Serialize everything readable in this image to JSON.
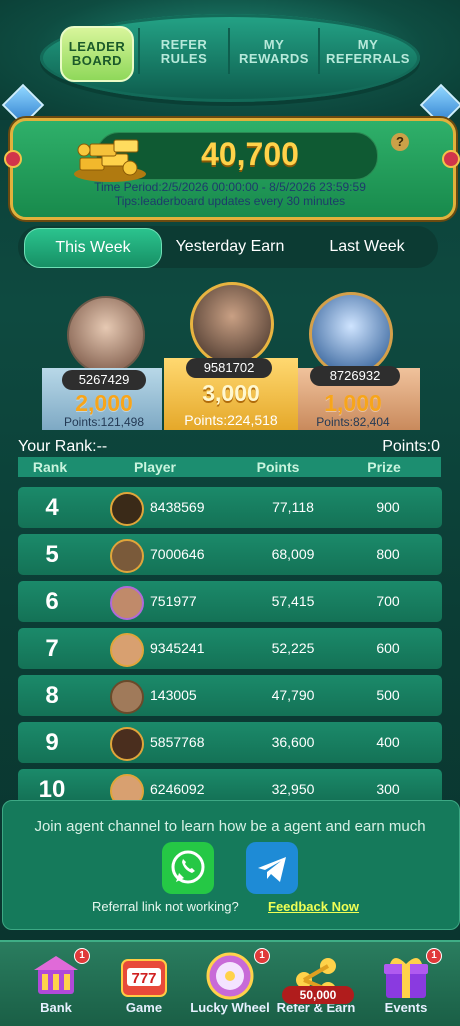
{
  "top_tabs": [
    {
      "label_line1": "LEADER",
      "label_line2": "BOARD"
    },
    {
      "label_line1": "REFER",
      "label_line2": "RULES"
    },
    {
      "label_line1": "MY",
      "label_line2": "REWARDS"
    },
    {
      "label_line1": "MY",
      "label_line2": "REFERRALS"
    }
  ],
  "banner": {
    "points": "40,700",
    "help": "?",
    "time_period": "Time Period:2/5/2026 00:00:00 - 8/5/2026 23:59:59",
    "tips": "Tips:leaderboard updates every 30 minutes"
  },
  "period_tabs": [
    "This Week",
    "Yesterday Earn",
    "Last Week"
  ],
  "podium": [
    {
      "id": "5267429",
      "amount": "2,000",
      "points": "Points:121,498"
    },
    {
      "id": "9581702",
      "amount": "3,000",
      "points": "Points:224,518"
    },
    {
      "id": "8726932",
      "amount": "1,000",
      "points": "Points:82,404"
    }
  ],
  "your_rank": "Your Rank:--",
  "your_points": "Points:0",
  "table_headers": [
    "Rank",
    "Player",
    "Points",
    "Prize"
  ],
  "rows": [
    {
      "rank": "4",
      "player": "8438569",
      "points": "77,118",
      "prize": "900"
    },
    {
      "rank": "5",
      "player": "7000646",
      "points": "68,009",
      "prize": "800"
    },
    {
      "rank": "6",
      "player": "751977",
      "points": "57,415",
      "prize": "700"
    },
    {
      "rank": "7",
      "player": "9345241",
      "points": "52,225",
      "prize": "600"
    },
    {
      "rank": "8",
      "player": "143005",
      "points": "47,790",
      "prize": "500"
    },
    {
      "rank": "9",
      "player": "5857768",
      "points": "36,600",
      "prize": "400"
    },
    {
      "rank": "10",
      "player": "6246092",
      "points": "32,950",
      "prize": "300"
    }
  ],
  "agent": {
    "text": "Join agent channel to learn how be a agent and earn much",
    "not_working": "Referral link not working?",
    "feedback": "Feedback Now"
  },
  "nav": [
    {
      "label": "Bank",
      "badge": "1"
    },
    {
      "label": "Game",
      "badge": ""
    },
    {
      "label": "Lucky Wheel",
      "badge": "1"
    },
    {
      "label": "Refer & Earn",
      "badge": "",
      "coins": "50,000"
    },
    {
      "label": "Events",
      "badge": "1"
    }
  ],
  "colors": {
    "accent": "#ffd24a",
    "banner": "#1f9a58",
    "row": "#177a5d"
  }
}
